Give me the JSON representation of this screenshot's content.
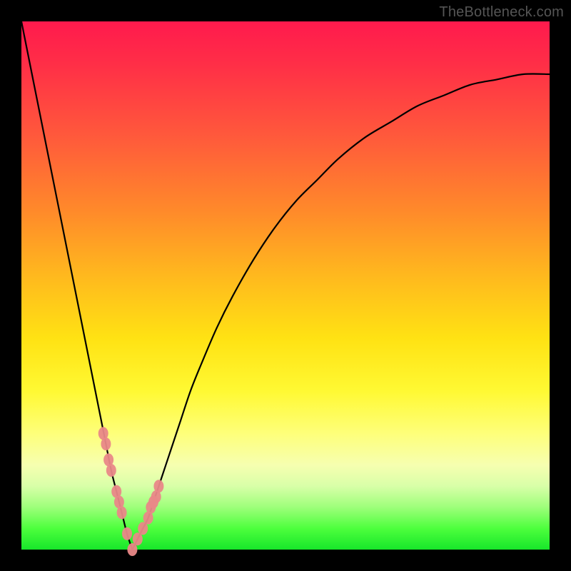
{
  "attribution": "TheBottleneck.com",
  "colors": {
    "frame": "#000000",
    "curve": "#000000",
    "marker": "#e98888",
    "gradient_stops": [
      "#ff1a4d",
      "#ff2e47",
      "#ff5a3b",
      "#ff8a2a",
      "#ffb81e",
      "#ffe213",
      "#fff933",
      "#feff7a",
      "#f6ffb0",
      "#d8ffa8",
      "#9dff7a",
      "#4dff3d",
      "#17e62a"
    ]
  },
  "chart_data": {
    "type": "line",
    "title": "",
    "xlabel": "",
    "ylabel": "",
    "xlim": [
      0,
      100
    ],
    "ylim": [
      0,
      100
    ],
    "grid": false,
    "legend": false,
    "note": "Bottleneck-style V curve. X ~ component ratio (arbitrary 0–100), Y ~ bottleneck % (0 best, 100 worst). Minimum (optimal) at x≈21.",
    "x": [
      0,
      2,
      4,
      6,
      8,
      10,
      12,
      14,
      15,
      16,
      17,
      18,
      19,
      20,
      21,
      22,
      23,
      24,
      25,
      26,
      27,
      28,
      30,
      32,
      34,
      37,
      40,
      44,
      48,
      52,
      56,
      60,
      65,
      70,
      75,
      80,
      85,
      90,
      95,
      100
    ],
    "values": [
      100,
      90,
      80,
      70,
      60,
      50,
      40,
      30,
      25,
      20,
      15,
      11,
      7,
      3,
      0,
      2,
      4,
      6,
      9,
      12,
      15,
      18,
      24,
      30,
      35,
      42,
      48,
      55,
      61,
      66,
      70,
      74,
      78,
      81,
      84,
      86,
      88,
      89,
      90,
      90
    ],
    "markers": {
      "x": [
        15.5,
        16,
        16.5,
        17,
        18,
        18.5,
        19,
        20,
        21,
        22,
        23,
        24,
        24.5,
        25,
        25.5,
        26
      ],
      "y": [
        22,
        20,
        17,
        15,
        11,
        9,
        7,
        3,
        0,
        2,
        4,
        6,
        8,
        9,
        10,
        12
      ]
    }
  }
}
